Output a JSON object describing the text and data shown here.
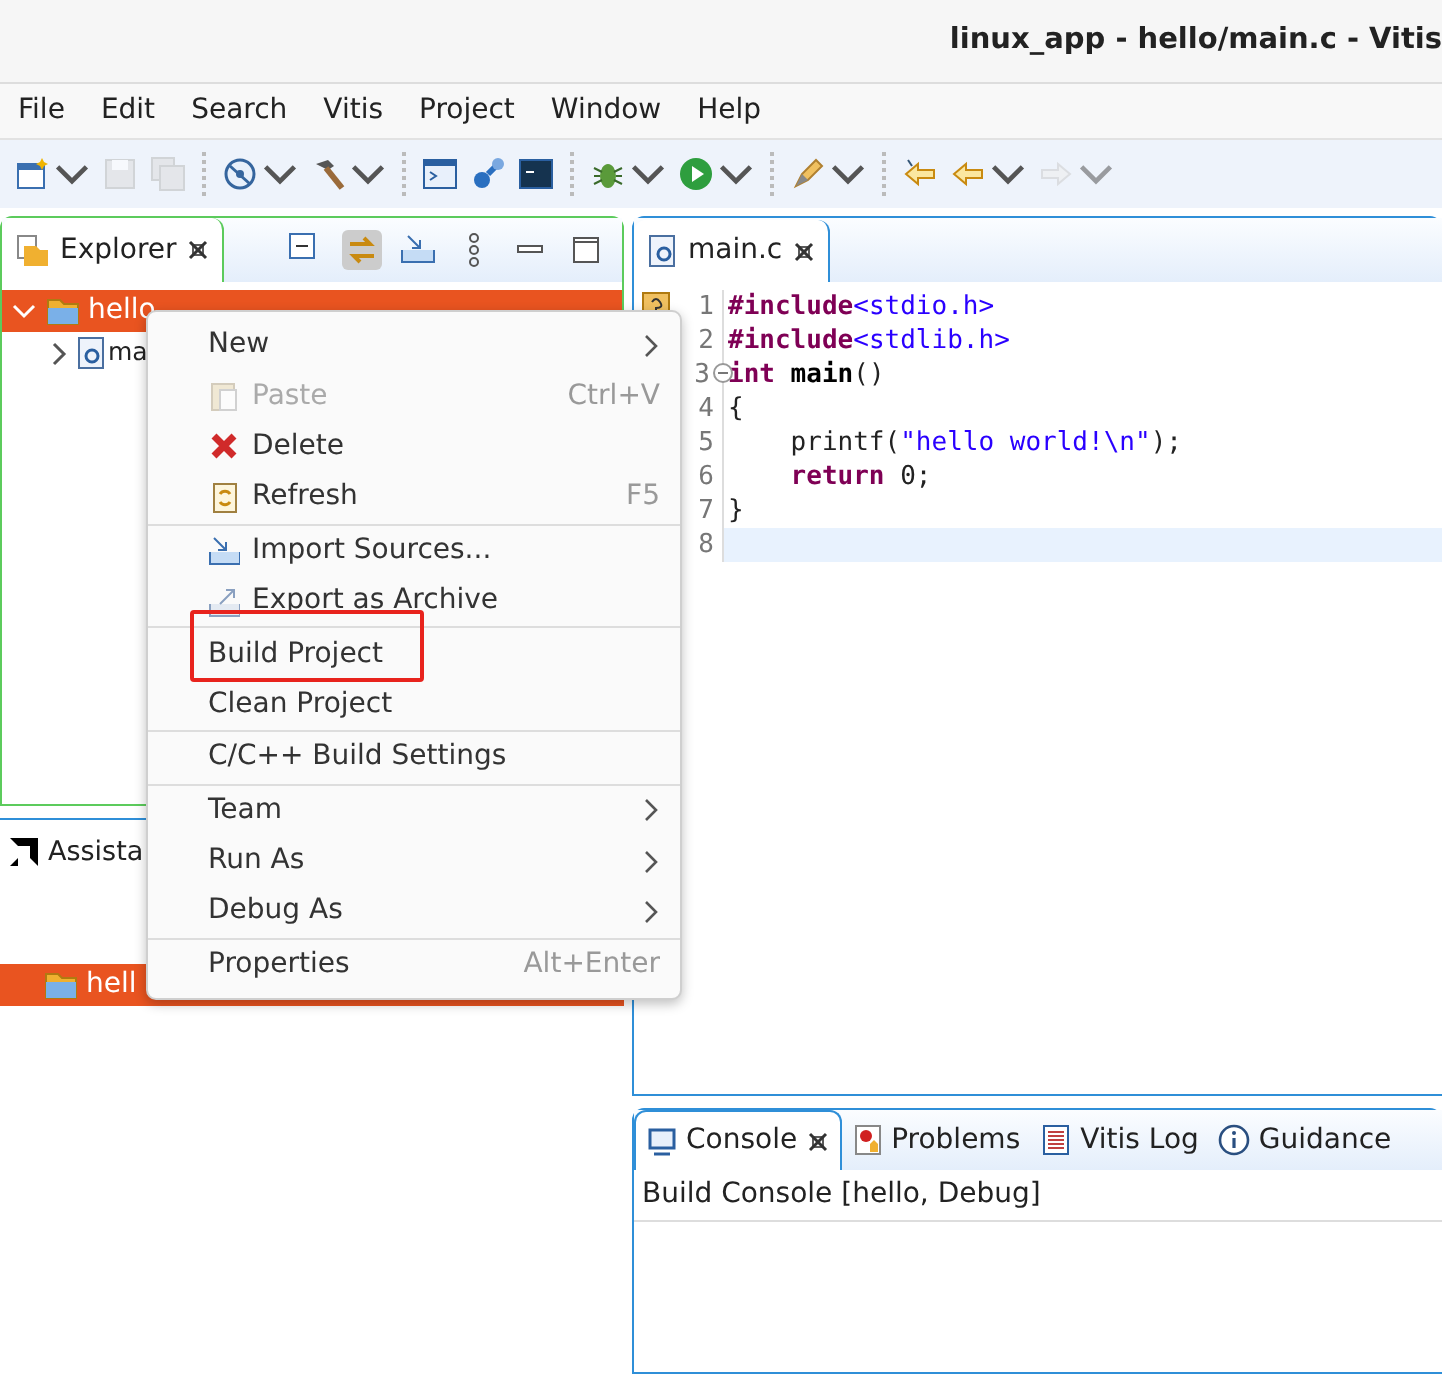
{
  "window": {
    "title": "linux_app - hello/main.c - Vitis"
  },
  "menu_bar": [
    "File",
    "Edit",
    "Search",
    "Vitis",
    "Project",
    "Window",
    "Help"
  ],
  "toolbar": [
    {
      "dropdown": true,
      "disabled": false
    },
    {
      "dropdown": false,
      "disabled": true
    },
    {
      "dropdown": false,
      "disabled": true
    },
    {
      "dropdown": true,
      "disabled": false
    },
    {
      "dropdown": true,
      "disabled": false
    },
    {
      "dropdown": false,
      "disabled": false
    },
    {
      "dropdown": false,
      "disabled": false
    },
    {
      "dropdown": false,
      "disabled": false
    },
    {
      "dropdown": true,
      "disabled": false
    },
    {
      "dropdown": true,
      "disabled": false
    },
    {
      "dropdown": true,
      "disabled": false
    },
    {
      "dropdown": false,
      "disabled": false
    },
    {
      "dropdown": true,
      "disabled": false
    },
    {
      "dropdown": true,
      "disabled": true
    }
  ],
  "explorer": {
    "tab": {
      "label": "Explorer",
      "selected": true
    },
    "tree": [
      {
        "label": "hello",
        "selected": true,
        "expanded": true,
        "children": [
          {
            "label": "ma",
            "selected": false,
            "expanded": false
          }
        ]
      }
    ]
  },
  "assistant": {
    "tab": {
      "label": "Assista"
    },
    "items": [
      {
        "label": "hell",
        "selected": true
      }
    ]
  },
  "editor": {
    "tab": {
      "label": "main.c",
      "selected": true
    },
    "lines": [
      {
        "number": "1",
        "warning": true,
        "foldable": false,
        "current": false,
        "tokens": [
          {
            "kind": "directive",
            "text": "#include"
          },
          {
            "kind": "header",
            "text": "<stdio.h>"
          }
        ]
      },
      {
        "number": "2",
        "foldable": false,
        "current": false,
        "tokens": [
          {
            "kind": "directive",
            "text": "#include"
          },
          {
            "kind": "header",
            "text": "<stdlib.h>"
          }
        ]
      },
      {
        "number": "3",
        "foldable": true,
        "current": false,
        "tokens": [
          {
            "kind": "keyword",
            "text": "int"
          },
          {
            "kind": "function",
            "text": " main"
          },
          {
            "kind": "plain",
            "text": "()"
          }
        ]
      },
      {
        "number": "4",
        "foldable": false,
        "current": false,
        "tokens": [
          {
            "kind": "plain",
            "text": "{"
          }
        ]
      },
      {
        "number": "5",
        "foldable": false,
        "current": false,
        "indented": true,
        "tokens": [
          {
            "kind": "plain",
            "text": "printf("
          },
          {
            "kind": "string",
            "text": "\"hello world!\\n\""
          },
          {
            "kind": "plain",
            "text": ");"
          }
        ]
      },
      {
        "number": "6",
        "foldable": false,
        "current": false,
        "indented": true,
        "tokens": [
          {
            "kind": "keyword",
            "text": "return"
          },
          {
            "kind": "plain",
            "text": " 0;"
          }
        ]
      },
      {
        "number": "7",
        "foldable": false,
        "current": false,
        "tokens": [
          {
            "kind": "plain",
            "text": "}"
          }
        ]
      },
      {
        "number": "8",
        "foldable": false,
        "current": true
      }
    ]
  },
  "console": {
    "tabs": [
      {
        "label": "Console",
        "selected": true
      },
      {
        "label": "Problems",
        "selected": false
      },
      {
        "label": "Vitis Log",
        "selected": false
      },
      {
        "label": "Guidance",
        "selected": false
      }
    ],
    "header": "Build Console [hello, Debug]"
  },
  "context_menu": [
    {
      "kind": "item",
      "label": "New",
      "submenu": true,
      "disabled": false,
      "highlighted": false
    },
    {
      "kind": "item",
      "label": "Paste",
      "shortcut": "Ctrl+V",
      "submenu": false,
      "disabled": true,
      "highlighted": false
    },
    {
      "kind": "item",
      "label": "Delete",
      "submenu": false,
      "disabled": false,
      "highlighted": false
    },
    {
      "kind": "item",
      "label": "Refresh",
      "shortcut": "F5",
      "submenu": false,
      "disabled": false,
      "highlighted": false
    },
    {
      "kind": "separator"
    },
    {
      "kind": "item",
      "label": "Import Sources...",
      "submenu": false,
      "disabled": false,
      "highlighted": false
    },
    {
      "kind": "item",
      "label": "Export as Archive",
      "submenu": false,
      "disabled": false,
      "highlighted": false
    },
    {
      "kind": "separator"
    },
    {
      "kind": "item",
      "label": "Build Project",
      "submenu": false,
      "disabled": false,
      "highlighted": true
    },
    {
      "kind": "item",
      "label": "Clean Project",
      "submenu": false,
      "disabled": false,
      "highlighted": false
    },
    {
      "kind": "separator"
    },
    {
      "kind": "item",
      "label": "C/C++ Build Settings",
      "submenu": false,
      "disabled": false,
      "highlighted": false
    },
    {
      "kind": "separator"
    },
    {
      "kind": "item",
      "label": "Team",
      "submenu": true,
      "disabled": false,
      "highlighted": false
    },
    {
      "kind": "item",
      "label": "Run As",
      "submenu": true,
      "disabled": false,
      "highlighted": false
    },
    {
      "kind": "item",
      "label": "Debug As",
      "submenu": true,
      "disabled": false,
      "highlighted": false
    },
    {
      "kind": "separator"
    },
    {
      "kind": "item",
      "label": "Properties",
      "shortcut": "Alt+Enter",
      "submenu": false,
      "disabled": false,
      "highlighted": false
    }
  ]
}
